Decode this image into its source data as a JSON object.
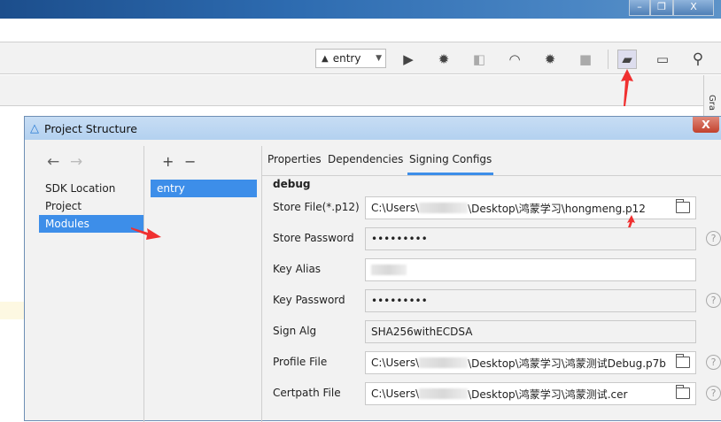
{
  "window": {
    "minimize": "–",
    "restore": "❐",
    "close": "X"
  },
  "toolbar": {
    "run_config": "entry",
    "icons": [
      "run-icon",
      "debug-icon",
      "attach-debugger-icon",
      "profile-icon",
      "debug-attach-icon",
      "stop-icon",
      "project-structure-icon",
      "device-manager-icon",
      "search-icon"
    ]
  },
  "right_strip": {
    "label": "Gra"
  },
  "dialog": {
    "title": "Project Structure",
    "close": "X",
    "nav": {
      "items": [
        "SDK Location",
        "Project",
        "Modules"
      ],
      "selected": "Modules"
    },
    "modules": {
      "add": "+",
      "remove": "−",
      "items": [
        "entry"
      ]
    },
    "tabs": [
      "Properties",
      "Dependencies",
      "Signing Configs"
    ],
    "active_tab": "Signing Configs",
    "section": "debug",
    "fields": [
      {
        "label": "Store File(*.p12)",
        "prefix": "C:\\Users\\",
        "value": "\\Desktop\\鸿蒙学习\\hongmeng.p12",
        "browse": true,
        "help": false
      },
      {
        "label": "Store Password",
        "value": "•••••••••",
        "help": true
      },
      {
        "label": "Key Alias",
        "value": "",
        "help": false
      },
      {
        "label": "Key Password",
        "value": "•••••••••",
        "help": true
      },
      {
        "label": "Sign Alg",
        "value": "SHA256withECDSA",
        "help": false
      },
      {
        "label": "Profile File",
        "prefix": "C:\\Users\\",
        "value": "\\Desktop\\鸿蒙学习\\鸿蒙测试Debug.p7b",
        "browse": true,
        "help": true
      },
      {
        "label": "Certpath File",
        "prefix": "C:\\Users\\",
        "value": "\\Desktop\\鸿蒙学习\\鸿蒙测试.cer",
        "browse": true,
        "help": true
      }
    ]
  },
  "colors": {
    "accent": "#3d8ee9",
    "annotation_arrow": "#f03030"
  }
}
